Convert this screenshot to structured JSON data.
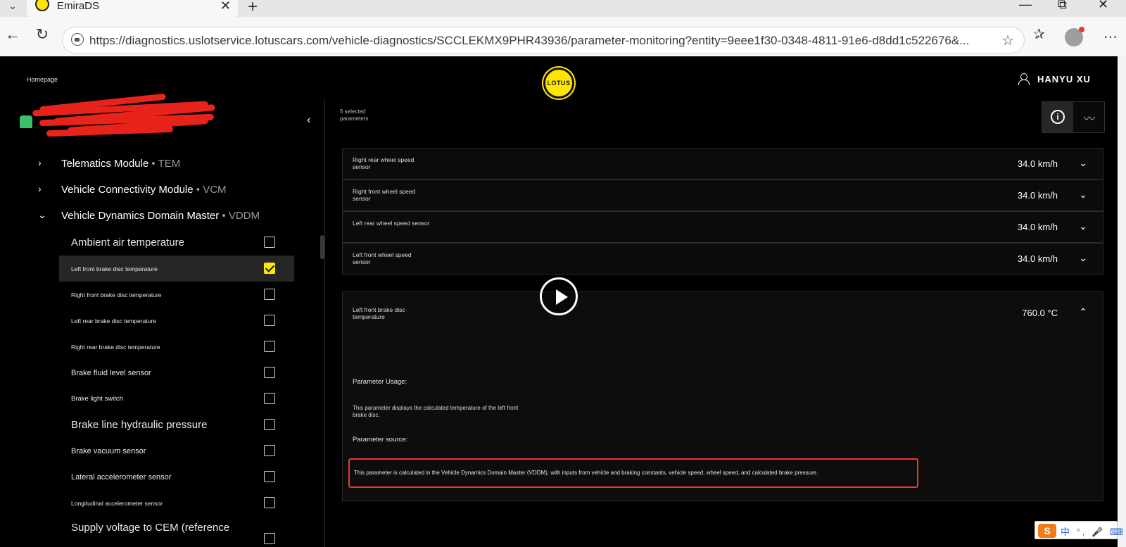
{
  "browser": {
    "tab_title": "EmiraDS",
    "url": "https://diagnostics.uslotservice.lotuscars.com/vehicle-diagnostics/SCCLEKMX9PHR43936/parameter-monitoring?entity=9eee1f30-0348-4811-91e6-d8dd1c522676&...",
    "new_tab_symbol": "+",
    "close_symbol": "✕",
    "minimize_symbol": "—",
    "restore_symbol": "⧉",
    "window_close_symbol": "✕",
    "back_symbol": "←",
    "reload_symbol": "↻",
    "star_symbol": "☆",
    "favorites_symbol": "✰",
    "more_symbol": "⋯",
    "tab_list_symbol": "⌄"
  },
  "header": {
    "homepage_link": "Homepage",
    "logo_text": "LOTUS",
    "user_name": "HANYU XU"
  },
  "sidebar": {
    "collapse_symbol": "‹",
    "modules": [
      {
        "chev": "›",
        "name": "Telematics Module",
        "code": " • TEM"
      },
      {
        "chev": "›",
        "name": "Vehicle Connectivity Module",
        "code": " • VCM"
      },
      {
        "chev": "⌄",
        "name": "Vehicle Dynamics Domain Master",
        "code": " • VDDM"
      }
    ],
    "parameters": [
      {
        "label": "Ambient air temperature",
        "checked": false
      },
      {
        "label": "Left front brake disc temperature",
        "checked": true
      },
      {
        "label": "Right front brake disc temperature",
        "checked": false
      },
      {
        "label": "Left rear brake disc temperature",
        "checked": false
      },
      {
        "label": "Right rear brake disc temperature",
        "checked": false
      },
      {
        "label": "Brake fluid level sensor",
        "checked": false
      },
      {
        "label": "Brake light switch",
        "checked": false
      },
      {
        "label": "Brake line hydraulic pressure",
        "checked": false
      },
      {
        "label": "Brake vacuum sensor",
        "checked": false
      },
      {
        "label": "Lateral accelerometer sensor",
        "checked": false
      },
      {
        "label": "Longitudinal accelerometer sensor",
        "checked": false
      },
      {
        "label": "Supply voltage to CEM (reference",
        "checked": false
      }
    ]
  },
  "monitor": {
    "selected_count": "5 selected parameters",
    "info_symbol": "i",
    "trend_symbol": "〰",
    "rows": [
      {
        "label": "Right rear wheel speed sensor",
        "value": "34.0 km/h",
        "chev": "⌄"
      },
      {
        "label": "Right front wheel speed sensor",
        "value": "34.0 km/h",
        "chev": "⌄"
      },
      {
        "label": "Left rear wheel speed sensor",
        "value": "34.0 km/h",
        "chev": "⌄"
      },
      {
        "label": "Left front wheel speed sensor",
        "value": "34.0 km/h",
        "chev": "⌄"
      }
    ],
    "expanded": {
      "label": "Left front brake disc temperature",
      "value": "760.0 °C",
      "chev": "⌃",
      "usage_title": "Parameter Usage:",
      "usage_text": "This parameter displays the calculated temperature of the left front brake disc.",
      "source_title": "Parameter source:",
      "source_text": "This parameter is calculated in the Vehicle Dynamics Domain Master (VDDM), with inputs from vehicle and braking constants, vehicle speed, wheel speed, and calculated brake pressure."
    }
  },
  "ime": {
    "logo": "S",
    "items": "中 °, 🎤 ⌨"
  },
  "colors": {
    "accent_yellow": "#ffe600",
    "highlight_red": "#e53935",
    "background": "#000000"
  }
}
